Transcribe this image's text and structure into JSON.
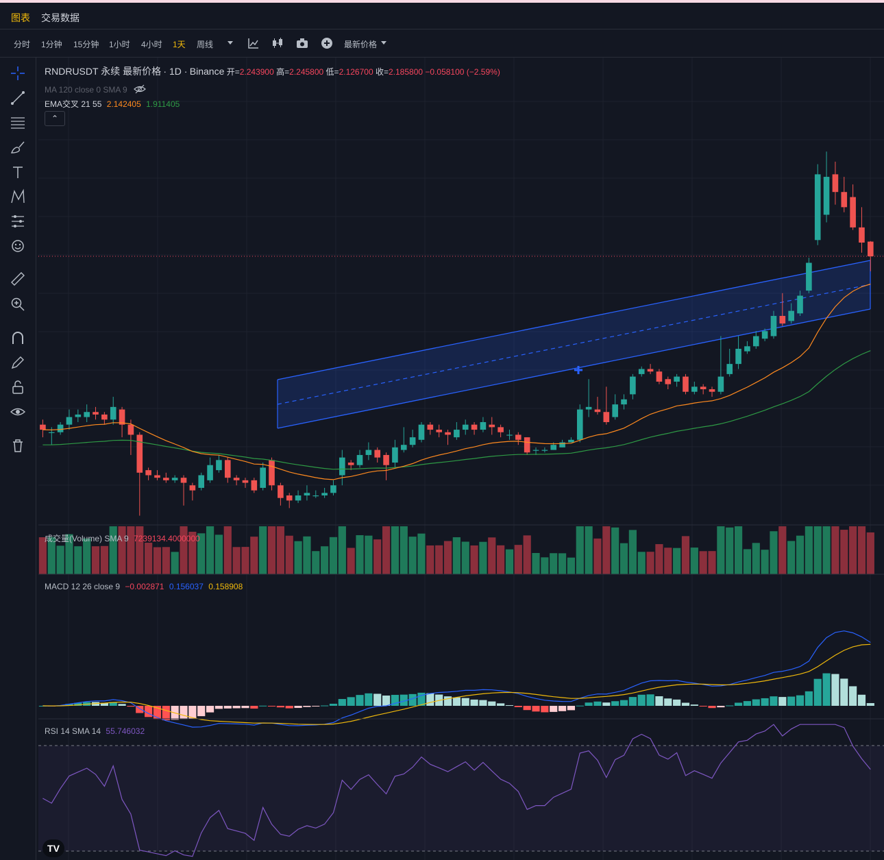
{
  "tabs": [
    {
      "label": "图表",
      "active": true
    },
    {
      "label": "交易数据",
      "active": false
    }
  ],
  "timeframes": [
    "分时",
    "1分钟",
    "15分钟",
    "1小时",
    "4小时",
    "1天",
    "周线"
  ],
  "active_timeframe": "1天",
  "price_type_label": "最新价格",
  "header": {
    "symbol": "RNDRUSDT 永续 最新价格",
    "interval": "· 1D ·",
    "exchange": "Binance",
    "open_label": "开=",
    "open": "2.243900",
    "high_label": "高=",
    "high": "2.245800",
    "low_label": "低=",
    "low": "2.126700",
    "close_label": "收=",
    "close": "2.185800",
    "change": "−0.058100 (−2.59%)"
  },
  "ma_label": "MA 120 close 0 SMA 9",
  "ema": {
    "label": "EMA交叉 21 55",
    "v1": "2.142405",
    "v2": "1.911405"
  },
  "volume": {
    "label": "成交量(Volume) SMA 9",
    "value": "7239134.4000000"
  },
  "macd": {
    "label": "MACD 12 26 close 9",
    "hist": "−0.002871",
    "macd": "0.156037",
    "signal": "0.158908"
  },
  "rsi": {
    "label": "RSI 14 SMA 14",
    "value": "55.746032"
  },
  "colors": {
    "up": "#26a69a",
    "down": "#ef5350",
    "ema_fast": "#ff8a1f",
    "ema_slow": "#2e9a45",
    "macd": "#2962ff",
    "signal": "#f0b90b",
    "rsi": "#7e57c2",
    "accent": "#f0b90b"
  },
  "icons": [
    "crosshair-icon",
    "trendline-icon",
    "fib-icon",
    "brush-icon",
    "text-icon",
    "pattern-icon",
    "measure-lines-icon",
    "emoji-icon",
    "ruler-icon",
    "zoom-icon",
    "magnet-icon",
    "lock-edit-icon",
    "lock-icon",
    "eye-icon",
    "trash-icon"
  ],
  "chart_data": {
    "type": "candlestick",
    "series": [
      {
        "name": "RNDRUSDT",
        "candles": [
          [
            1.52,
            1.5,
            1.54,
            1.47
          ],
          [
            1.49,
            1.49,
            1.51,
            1.44
          ],
          [
            1.49,
            1.52,
            1.53,
            1.48
          ],
          [
            1.52,
            1.55,
            1.58,
            1.5
          ],
          [
            1.55,
            1.56,
            1.58,
            1.53
          ],
          [
            1.55,
            1.57,
            1.6,
            1.53
          ],
          [
            1.57,
            1.56,
            1.59,
            1.54
          ],
          [
            1.56,
            1.54,
            1.57,
            1.52
          ],
          [
            1.54,
            1.59,
            1.63,
            1.52
          ],
          [
            1.58,
            1.52,
            1.59,
            1.47
          ],
          [
            1.52,
            1.48,
            1.54,
            1.4
          ],
          [
            1.48,
            1.33,
            1.49,
            1.16
          ],
          [
            1.34,
            1.32,
            1.35,
            1.3
          ],
          [
            1.32,
            1.31,
            1.34,
            1.3
          ],
          [
            1.31,
            1.3,
            1.33,
            1.29
          ],
          [
            1.3,
            1.31,
            1.32,
            1.29
          ],
          [
            1.31,
            1.29,
            1.32,
            1.2
          ],
          [
            1.28,
            1.26,
            1.29,
            1.22
          ],
          [
            1.27,
            1.32,
            1.33,
            1.26
          ],
          [
            1.3,
            1.36,
            1.39,
            1.29
          ],
          [
            1.34,
            1.38,
            1.4,
            1.33
          ],
          [
            1.38,
            1.31,
            1.39,
            1.29
          ],
          [
            1.31,
            1.3,
            1.32,
            1.28
          ],
          [
            1.3,
            1.29,
            1.31,
            1.27
          ],
          [
            1.3,
            1.26,
            1.31,
            1.25
          ],
          [
            1.27,
            1.35,
            1.37,
            1.26
          ],
          [
            1.38,
            1.28,
            1.39,
            1.26
          ],
          [
            1.28,
            1.23,
            1.29,
            1.2
          ],
          [
            1.24,
            1.22,
            1.25,
            1.19
          ],
          [
            1.22,
            1.24,
            1.26,
            1.21
          ],
          [
            1.24,
            1.25,
            1.28,
            1.22
          ],
          [
            1.24,
            1.24,
            1.26,
            1.23
          ],
          [
            1.24,
            1.25,
            1.27,
            1.23
          ],
          [
            1.25,
            1.28,
            1.3,
            1.24
          ],
          [
            1.32,
            1.39,
            1.42,
            1.28
          ],
          [
            1.37,
            1.36,
            1.38,
            1.34
          ],
          [
            1.36,
            1.4,
            1.42,
            1.35
          ],
          [
            1.4,
            1.42,
            1.45,
            1.38
          ],
          [
            1.42,
            1.39,
            1.43,
            1.37
          ],
          [
            1.4,
            1.36,
            1.41,
            1.3
          ],
          [
            1.37,
            1.43,
            1.46,
            1.35
          ],
          [
            1.42,
            1.44,
            1.51,
            1.41
          ],
          [
            1.44,
            1.47,
            1.5,
            1.43
          ],
          [
            1.46,
            1.52,
            1.53,
            1.45
          ],
          [
            1.52,
            1.5,
            1.53,
            1.48
          ],
          [
            1.5,
            1.49,
            1.52,
            1.47
          ],
          [
            1.49,
            1.48,
            1.5,
            1.44
          ],
          [
            1.47,
            1.5,
            1.53,
            1.46
          ],
          [
            1.5,
            1.52,
            1.54,
            1.48
          ],
          [
            1.52,
            1.5,
            1.53,
            1.48
          ],
          [
            1.5,
            1.53,
            1.55,
            1.49
          ],
          [
            1.52,
            1.51,
            1.55,
            1.48
          ],
          [
            1.51,
            1.49,
            1.52,
            1.47
          ],
          [
            1.48,
            1.48,
            1.5,
            1.46
          ],
          [
            1.48,
            1.46,
            1.49,
            1.44
          ],
          [
            1.47,
            1.41,
            1.47,
            1.4
          ],
          [
            1.42,
            1.42,
            1.43,
            1.4
          ],
          [
            1.42,
            1.42,
            1.43,
            1.41
          ],
          [
            1.42,
            1.44,
            1.45,
            1.42
          ],
          [
            1.43,
            1.45,
            1.46,
            1.43
          ],
          [
            1.45,
            1.46,
            1.47,
            1.45
          ],
          [
            1.46,
            1.58,
            1.6,
            1.45
          ],
          [
            1.58,
            1.59,
            1.7,
            1.55
          ],
          [
            1.58,
            1.57,
            1.63,
            1.56
          ],
          [
            1.57,
            1.53,
            1.67,
            1.52
          ],
          [
            1.55,
            1.6,
            1.64,
            1.54
          ],
          [
            1.6,
            1.62,
            1.64,
            1.58
          ],
          [
            1.64,
            1.71,
            1.72,
            1.62
          ],
          [
            1.72,
            1.74,
            1.75,
            1.71
          ],
          [
            1.74,
            1.73,
            1.76,
            1.72
          ],
          [
            1.73,
            1.69,
            1.74,
            1.68
          ],
          [
            1.7,
            1.68,
            1.71,
            1.66
          ],
          [
            1.69,
            1.71,
            1.72,
            1.67
          ],
          [
            1.71,
            1.65,
            1.72,
            1.64
          ],
          [
            1.65,
            1.67,
            1.69,
            1.64
          ],
          [
            1.67,
            1.66,
            1.68,
            1.64
          ],
          [
            1.66,
            1.65,
            1.67,
            1.63
          ],
          [
            1.65,
            1.71,
            1.87,
            1.64
          ],
          [
            1.72,
            1.76,
            1.82,
            1.71
          ],
          [
            1.76,
            1.82,
            1.87,
            1.74
          ],
          [
            1.81,
            1.83,
            1.85,
            1.8
          ],
          [
            1.83,
            1.87,
            1.89,
            1.82
          ],
          [
            1.86,
            1.89,
            1.9,
            1.85
          ],
          [
            1.87,
            1.95,
            1.97,
            1.86
          ],
          [
            1.95,
            1.92,
            2.04,
            1.91
          ],
          [
            1.93,
            1.97,
            2.0,
            1.92
          ],
          [
            1.96,
            2.03,
            2.05,
            1.95
          ],
          [
            2.05,
            2.16,
            2.18,
            2.04
          ],
          [
            2.25,
            2.51,
            2.55,
            2.23
          ],
          [
            2.35,
            2.5,
            2.6,
            2.32
          ],
          [
            2.51,
            2.44,
            2.56,
            2.39
          ],
          [
            2.44,
            2.38,
            2.5,
            2.36
          ],
          [
            2.42,
            2.3,
            2.47,
            2.29
          ],
          [
            2.3,
            2.24,
            2.38,
            2.2
          ],
          [
            2.2439,
            2.1858,
            2.2458,
            2.1267
          ]
        ]
      }
    ],
    "overlays": [
      "EMA 21",
      "EMA 55",
      "Parallel channel"
    ]
  }
}
